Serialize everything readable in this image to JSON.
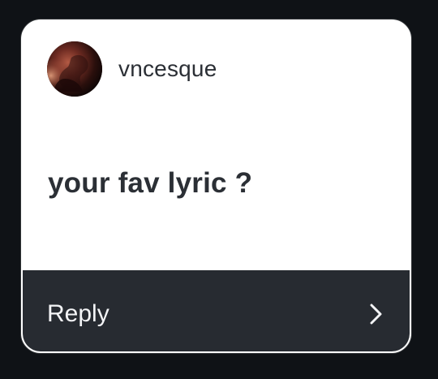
{
  "card": {
    "username": "vncesque",
    "question": "your fav lyric ?",
    "reply_label": "Reply"
  },
  "icons": {
    "avatar": "avatar-photo",
    "chevron": "chevron-right-icon"
  },
  "colors": {
    "background": "#0f1216",
    "card_background": "#ffffff",
    "footer_background": "#272b31",
    "text_dark": "#2b2f35",
    "text_light": "#f3f4f6"
  }
}
